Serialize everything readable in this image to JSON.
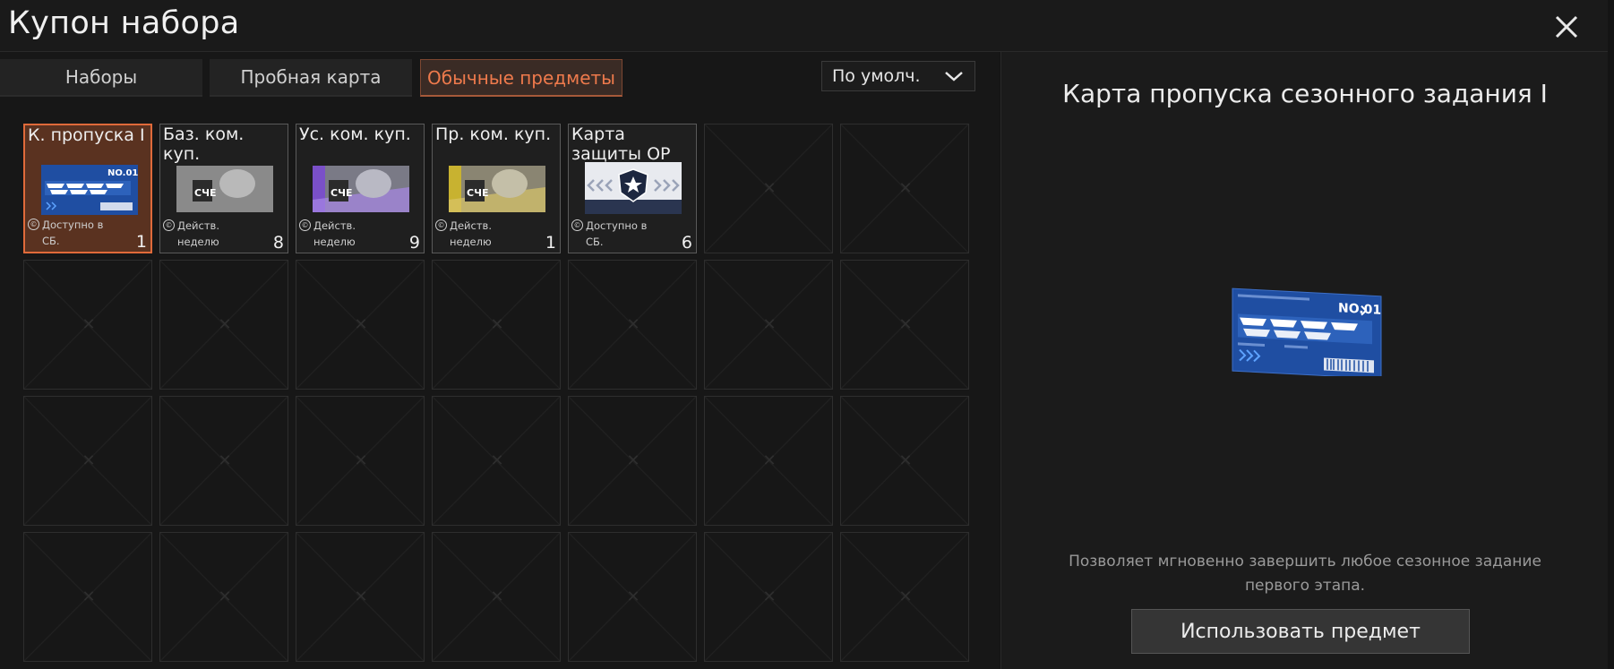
{
  "header": {
    "title": "Купон набора"
  },
  "tabs": [
    {
      "label": "Наборы",
      "active": false
    },
    {
      "label": "Пробная карта",
      "active": false
    },
    {
      "label": "Обычные предметы",
      "active": true
    }
  ],
  "sort": {
    "selected": "По умолч."
  },
  "items": [
    {
      "name": "К. пропуска I",
      "status": "Доступно в СБ.",
      "count": "1",
      "image": "season-pass-card-icon",
      "selected": true
    },
    {
      "name": "Баз. ком. куп.",
      "status": "Действ. неделю",
      "count": "8",
      "image": "command-coupon-grey-icon",
      "selected": false
    },
    {
      "name": "Ус. ком. куп.",
      "status": "Действ. неделю",
      "count": "9",
      "image": "command-coupon-purple-icon",
      "selected": false
    },
    {
      "name": "Пр. ком. куп.",
      "status": "Действ. неделю",
      "count": "1",
      "image": "command-coupon-gold-icon",
      "selected": false
    },
    {
      "name": "Карта защиты ОР",
      "status": "Доступно в СБ.",
      "count": "6",
      "image": "protection-card-icon",
      "selected": false
    }
  ],
  "detail": {
    "title": "Карта пропуска сезонного задания I",
    "description": "Позволяет мгновенно завершить любое сезонное задание первого этапа.",
    "use_button": "Использовать предмет",
    "image": "season-pass-card-icon"
  },
  "colors": {
    "accent": "#e06a3a",
    "active_tab_text": "#ee7a4c",
    "background": "#141414"
  }
}
